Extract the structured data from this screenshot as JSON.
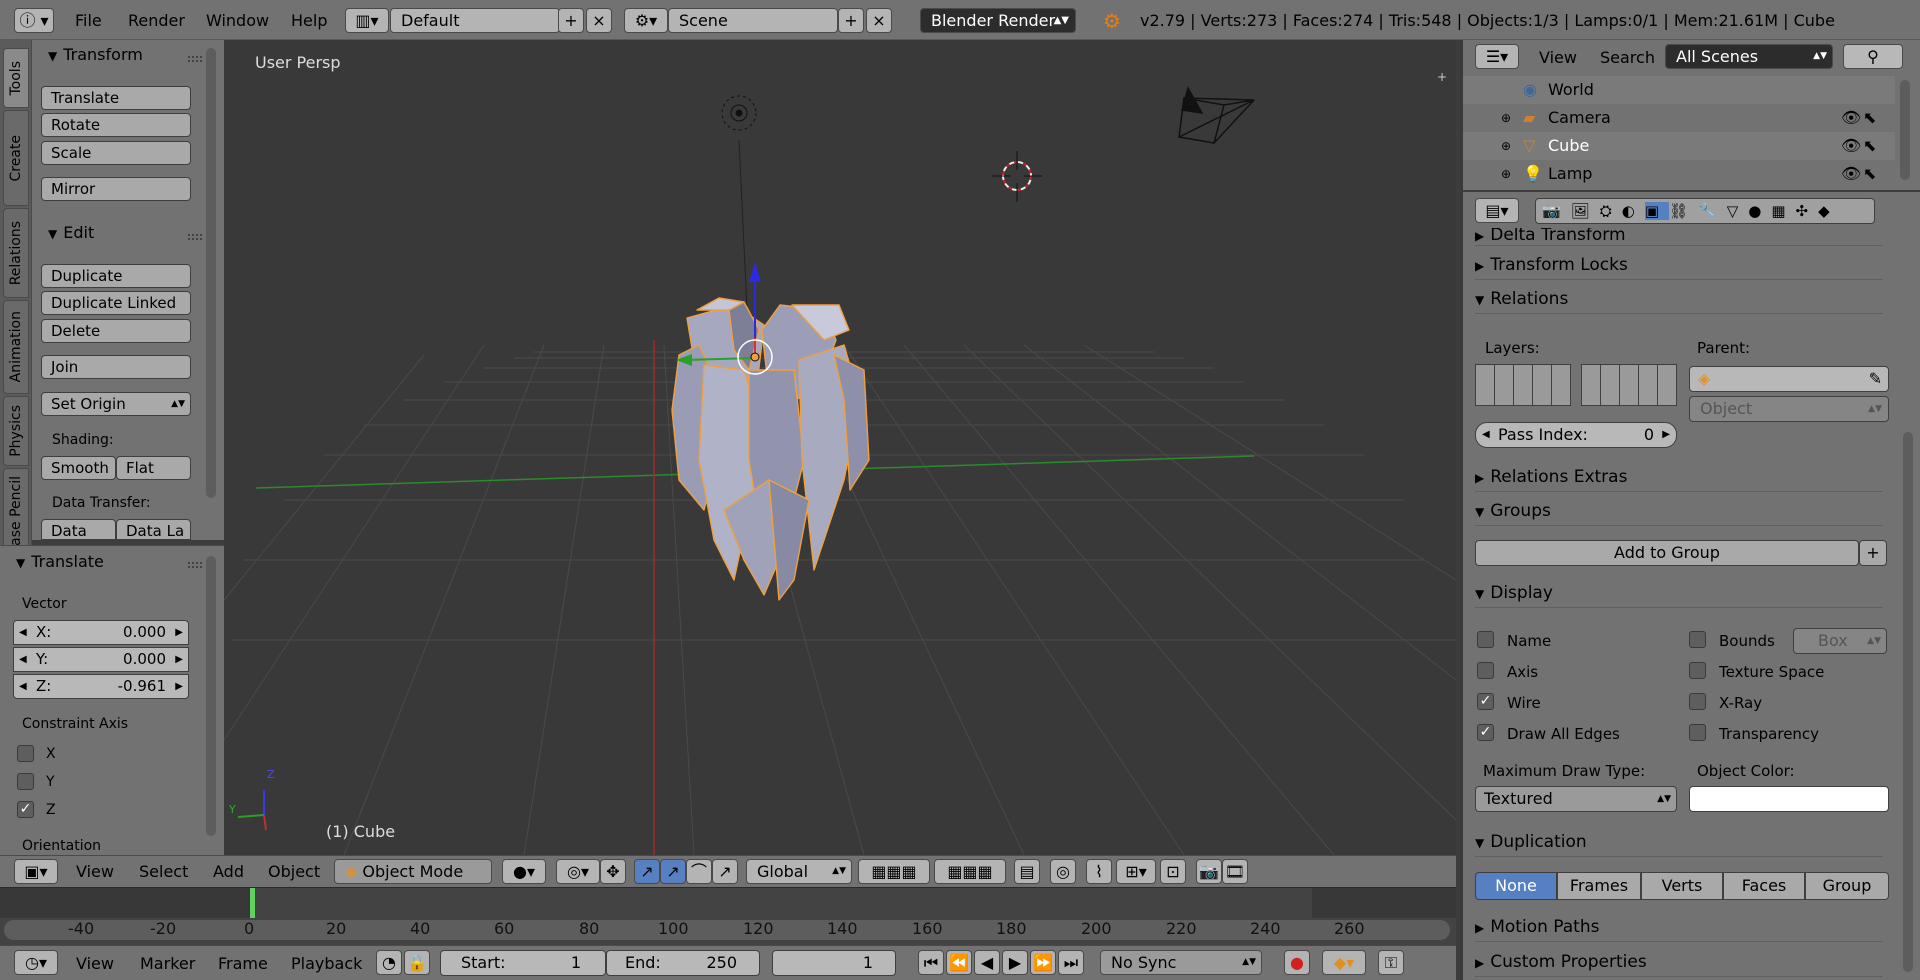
{
  "topbar": {
    "menu": [
      "File",
      "Render",
      "Window",
      "Help"
    ],
    "screen_layout": "Default",
    "scene": "Scene",
    "engine": "Blender Render",
    "stats": "v2.79 | Verts:273 | Faces:274 | Tris:548 | Objects:1/3 | Lamps:0/1 | Mem:21.61M | Cube"
  },
  "left_tabs": [
    "Tools",
    "Create",
    "Relations",
    "Animation",
    "Physics",
    "Grease Pencil"
  ],
  "tool_panel": {
    "transform_title": "Transform",
    "transform_buttons": [
      "Translate",
      "Rotate",
      "Scale"
    ],
    "mirror": "Mirror",
    "edit_title": "Edit",
    "edit_buttons": [
      "Duplicate",
      "Duplicate Linked",
      "Delete"
    ],
    "join": "Join",
    "set_origin": "Set Origin",
    "shading_label": "Shading:",
    "smooth": "Smooth",
    "flat": "Flat",
    "data_transfer_label": "Data Transfer:",
    "data": "Data",
    "data_la": "Data La"
  },
  "operator_panel": {
    "title": "Translate",
    "vector_label": "Vector",
    "x_label": "X:",
    "x_value": "0.000",
    "y_label": "Y:",
    "y_value": "0.000",
    "z_label": "Z:",
    "z_value": "-0.961",
    "constraint_label": "Constraint Axis",
    "axis_x": "X",
    "axis_y": "Y",
    "axis_z": "Z",
    "axis_x_checked": false,
    "axis_y_checked": false,
    "axis_z_checked": true,
    "orientation_label": "Orientation"
  },
  "viewport": {
    "view_name": "User Persp",
    "object_label": "(1) Cube",
    "axis_z": "Z",
    "axis_y": "Y"
  },
  "viewport_header": {
    "menu": [
      "View",
      "Select",
      "Add",
      "Object"
    ],
    "mode": "Object Mode",
    "orientation": "Global"
  },
  "timeline": {
    "ticks": [
      "-40",
      "-20",
      "0",
      "20",
      "40",
      "60",
      "80",
      "100",
      "120",
      "140",
      "160",
      "180",
      "200",
      "220",
      "240",
      "260"
    ],
    "current_frame_marker": 1
  },
  "timeline_bar": {
    "menu": [
      "View",
      "Marker",
      "Frame",
      "Playback"
    ],
    "start_label": "Start:",
    "start_value": "1",
    "end_label": "End:",
    "end_value": "250",
    "current_value": "1",
    "sync": "No Sync"
  },
  "outliner": {
    "menu": [
      "View",
      "Search"
    ],
    "filter": "All Scenes",
    "items": [
      {
        "name": "World"
      },
      {
        "name": "Camera"
      },
      {
        "name": "Cube"
      },
      {
        "name": "Lamp"
      }
    ]
  },
  "properties": {
    "sections": {
      "delta_transform": "Delta Transform",
      "transform_locks": "Transform Locks",
      "relations": "Relations",
      "relations_extras": "Relations Extras",
      "groups": "Groups",
      "display": "Display",
      "duplication": "Duplication",
      "motion_paths": "Motion Paths",
      "custom_properties": "Custom Properties"
    },
    "layers_label": "Layers:",
    "parent_label": "Parent:",
    "parent_type": "Object",
    "pass_index_label": "Pass Index:",
    "pass_index_value": "0",
    "add_to_group": "Add to Group",
    "display": {
      "name": "Name",
      "axis": "Axis",
      "wire": "Wire",
      "draw_all_edges": "Draw All Edges",
      "bounds": "Bounds",
      "bounds_type": "Box",
      "texture_space": "Texture Space",
      "xray": "X-Ray",
      "transparency": "Transparency",
      "name_checked": false,
      "axis_checked": false,
      "wire_checked": true,
      "draw_all_edges_checked": true,
      "bounds_checked": false,
      "texture_space_checked": false,
      "xray_checked": false,
      "transparency_checked": false,
      "max_draw_type_label": "Maximum Draw Type:",
      "max_draw_type": "Textured",
      "object_color_label": "Object Color:"
    },
    "duplication": {
      "options": [
        "None",
        "Frames",
        "Verts",
        "Faces",
        "Group"
      ],
      "selected": "None"
    }
  },
  "colors": {
    "panel": "#727272",
    "viewport_bg": "#393939",
    "selected_outline": "#f0a040",
    "active_blue": "#5680c2",
    "grid_line": "#4a4a4a",
    "x_axis": "#c03030",
    "y_axis": "#30a030"
  }
}
